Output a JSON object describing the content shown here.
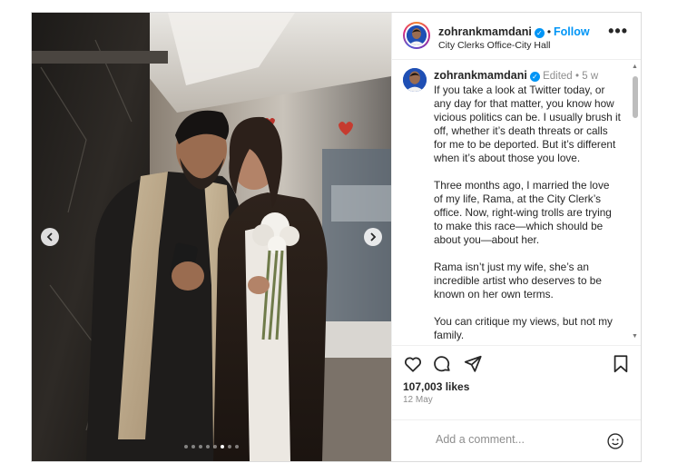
{
  "post": {
    "username": "zohrankmamdani",
    "follow_label": "Follow",
    "separator": "•",
    "location": "City Clerks Office-City Hall",
    "more_label": "•••",
    "caption": {
      "username": "zohrankmamdani",
      "edited": "Edited",
      "dot": "•",
      "age": "5 w",
      "paragraphs": [
        "If you take a look at Twitter today, or any day for that matter, you know how vicious politics can be. I usually brush it off, whether it’s death threats or calls for me to be deported. But it’s different when it’s about those you love.",
        "Three months ago, I married the love of my life, Rama, at the City Clerk’s office. Now, right-wing trolls are trying to make this race—which should be about you—about her.",
        "Rama isn’t just my wife, she’s an incredible artist who deserves to be known on her own terms.",
        "You can critique my views, but not my family."
      ]
    },
    "likes": "107,003 likes",
    "date": "12 May",
    "comment_placeholder": "Add a comment...",
    "carousel": {
      "count": 8,
      "active_index": 5
    }
  },
  "icons": {
    "prev": "chevron-left-icon",
    "next": "chevron-right-icon",
    "like": "heart-icon",
    "comment": "comment-icon",
    "share": "share-icon",
    "save": "bookmark-icon",
    "emoji": "emoji-icon",
    "verified": "verified-badge-icon",
    "more": "more-options-icon"
  },
  "colors": {
    "accent": "#0095f6",
    "text": "#262626",
    "muted": "#8e8e8e",
    "border": "#dbdbdb"
  }
}
